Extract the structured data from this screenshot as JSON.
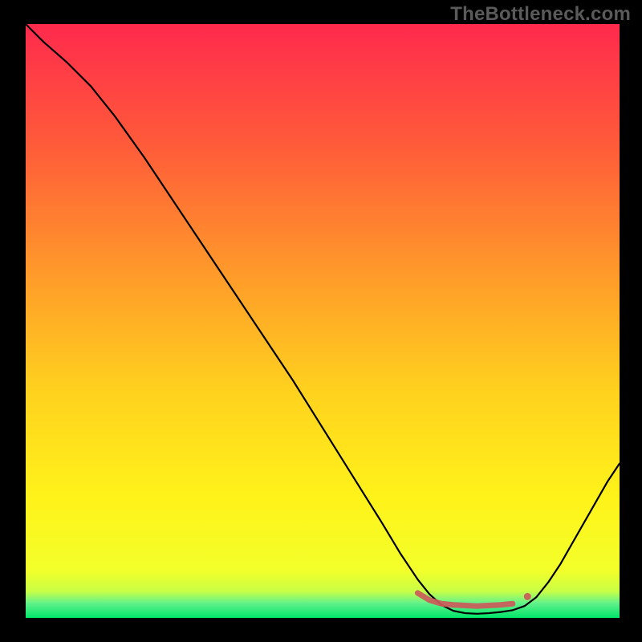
{
  "watermark": "TheBottleneck.com",
  "chart_data": {
    "type": "line",
    "title": "",
    "xlabel": "",
    "ylabel": "",
    "xlim": [
      0,
      100
    ],
    "ylim": [
      0,
      100
    ],
    "gradient_stops": [
      {
        "offset": 0.0,
        "color": "#ff2a4d"
      },
      {
        "offset": 0.2,
        "color": "#ff5a3a"
      },
      {
        "offset": 0.42,
        "color": "#ff9a2a"
      },
      {
        "offset": 0.62,
        "color": "#ffd21e"
      },
      {
        "offset": 0.8,
        "color": "#fff31a"
      },
      {
        "offset": 0.92,
        "color": "#f3ff2a"
      },
      {
        "offset": 0.955,
        "color": "#c9ff45"
      },
      {
        "offset": 0.975,
        "color": "#63f28a"
      },
      {
        "offset": 1.0,
        "color": "#00e56a"
      }
    ],
    "series": [
      {
        "name": "curve",
        "stroke": "#000000",
        "stroke_width": 2.2,
        "points": [
          {
            "x": 0,
            "y": 100
          },
          {
            "x": 3,
            "y": 97
          },
          {
            "x": 7,
            "y": 93.5
          },
          {
            "x": 11,
            "y": 89.5
          },
          {
            "x": 15,
            "y": 84.5
          },
          {
            "x": 20,
            "y": 77.5
          },
          {
            "x": 25,
            "y": 70
          },
          {
            "x": 30,
            "y": 62.5
          },
          {
            "x": 35,
            "y": 55
          },
          {
            "x": 40,
            "y": 47.5
          },
          {
            "x": 45,
            "y": 40
          },
          {
            "x": 50,
            "y": 32
          },
          {
            "x": 55,
            "y": 24
          },
          {
            "x": 60,
            "y": 16
          },
          {
            "x": 63,
            "y": 11
          },
          {
            "x": 66,
            "y": 6.5
          },
          {
            "x": 68,
            "y": 4
          },
          {
            "x": 70,
            "y": 2.2
          },
          {
            "x": 72,
            "y": 1.2
          },
          {
            "x": 74,
            "y": 0.8
          },
          {
            "x": 76,
            "y": 0.7
          },
          {
            "x": 78,
            "y": 0.8
          },
          {
            "x": 80,
            "y": 1.0
          },
          {
            "x": 82,
            "y": 1.3
          },
          {
            "x": 84,
            "y": 2.0
          },
          {
            "x": 86,
            "y": 3.5
          },
          {
            "x": 88,
            "y": 6
          },
          {
            "x": 90,
            "y": 9
          },
          {
            "x": 92,
            "y": 12.5
          },
          {
            "x": 94,
            "y": 16
          },
          {
            "x": 96,
            "y": 19.5
          },
          {
            "x": 98,
            "y": 23
          },
          {
            "x": 100,
            "y": 26
          }
        ]
      }
    ],
    "markers": {
      "name": "highlight-flat",
      "stroke": "#cc5a5a",
      "stroke_width": 7,
      "opacity": 0.92,
      "dot_radius": 4.5,
      "segment": [
        {
          "x": 66,
          "y": 4.2
        },
        {
          "x": 68,
          "y": 3.0
        },
        {
          "x": 70,
          "y": 2.4
        },
        {
          "x": 72,
          "y": 2.2
        },
        {
          "x": 74,
          "y": 2.1
        },
        {
          "x": 76,
          "y": 2.0
        },
        {
          "x": 78,
          "y": 2.1
        },
        {
          "x": 80,
          "y": 2.2
        },
        {
          "x": 82,
          "y": 2.4
        }
      ],
      "end_dot": {
        "x": 84.5,
        "y": 3.6
      }
    }
  }
}
